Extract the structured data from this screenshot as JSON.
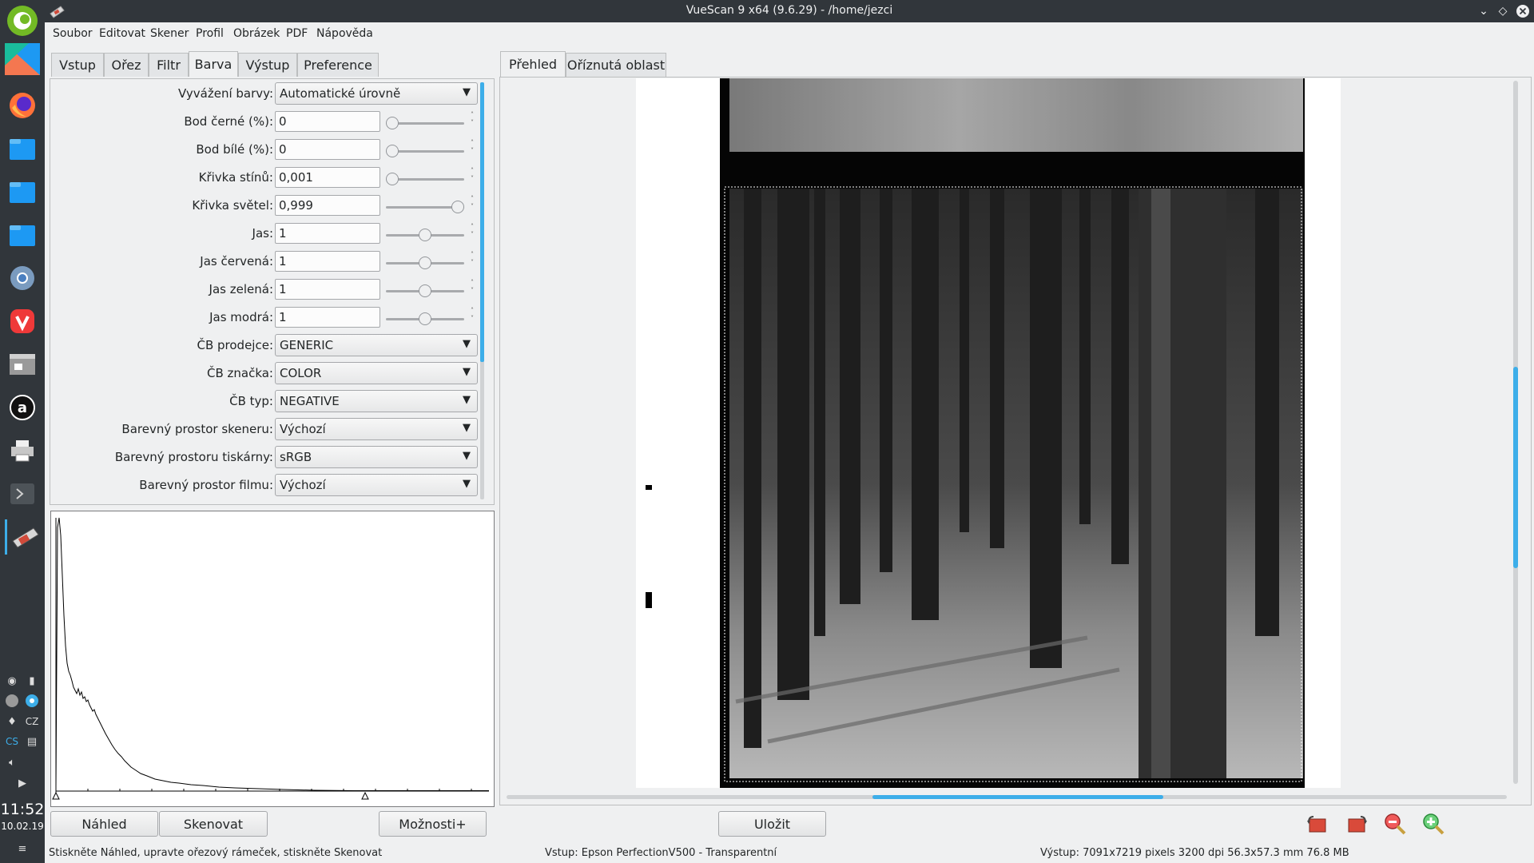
{
  "window": {
    "title": "VueScan 9 x64 (9.6.29) - /home/jezci"
  },
  "menu": [
    "Soubor",
    "Editovat",
    "Skener",
    "Profil",
    "Obrázek",
    "PDF",
    "Nápověda"
  ],
  "settings_tabs": [
    "Vstup",
    "Ořez",
    "Filtr",
    "Barva",
    "Výstup",
    "Preference"
  ],
  "settings_active_tab": "Barva",
  "preview_tabs": [
    "Přehled",
    "Oříznutá oblast"
  ],
  "rows": {
    "color_balance": {
      "label": "Vyvážení barvy:",
      "value": "Automatické úrovně"
    },
    "black_point": {
      "label": "Bod černé (%):",
      "value": "0",
      "level": 0
    },
    "white_point": {
      "label": "Bod bílé (%):",
      "value": "0",
      "level": 0
    },
    "shadow_curve": {
      "label": "Křivka stínů:",
      "value": "0,001",
      "level": 0.001
    },
    "highlight_curve": {
      "label": "Křivka světel:",
      "value": "0,999",
      "level": 0.999
    },
    "brightness": {
      "label": "Jas:",
      "value": "1",
      "level": 0.5
    },
    "brightness_red": {
      "label": "Jas červená:",
      "value": "1",
      "level": 0.5
    },
    "brightness_green": {
      "label": "Jas zelená:",
      "value": "1",
      "level": 0.5
    },
    "brightness_blue": {
      "label": "Jas modrá:",
      "value": "1",
      "level": 0.5
    },
    "film_vendor": {
      "label": "ČB prodejce:",
      "value": "GENERIC"
    },
    "film_brand": {
      "label": "ČB značka:",
      "value": "COLOR"
    },
    "film_type": {
      "label": "ČB typ:",
      "value": "NEGATIVE"
    },
    "scanner_color_space": {
      "label": "Barevný prostor skeneru:",
      "value": "Výchozí"
    },
    "printer_color_space": {
      "label": "Barevný prostoru tiskárny:",
      "value": "sRGB"
    },
    "film_color_space": {
      "label": "Barevný prostor filmu:",
      "value": "Výchozí"
    }
  },
  "buttons": {
    "preview": "Náhled",
    "scan": "Skenovat",
    "options": "Možnosti+",
    "save": "Uložit"
  },
  "toolbar_icons": [
    "rotate-left-icon",
    "rotate-right-icon",
    "zoom-out-icon",
    "zoom-in-icon"
  ],
  "status": {
    "hint": "Stiskněte Náhled, upravte ořezový rámeček, stiskněte Skenovat",
    "input": "Vstup: Epson PerfectionV500 - Transparentní",
    "output": "Výstup: 7091x7219 pixels 3200 dpi 56.3x57.3 mm 76.8 MB"
  },
  "clock": {
    "time": "11:52",
    "date": "10.02.19"
  },
  "tray": {
    "keyboard_layout": "CZ",
    "lang": "CS"
  },
  "colors": {
    "accent": "#3daee9",
    "panel_dark": "#31363b",
    "background": "#eff0f1"
  }
}
